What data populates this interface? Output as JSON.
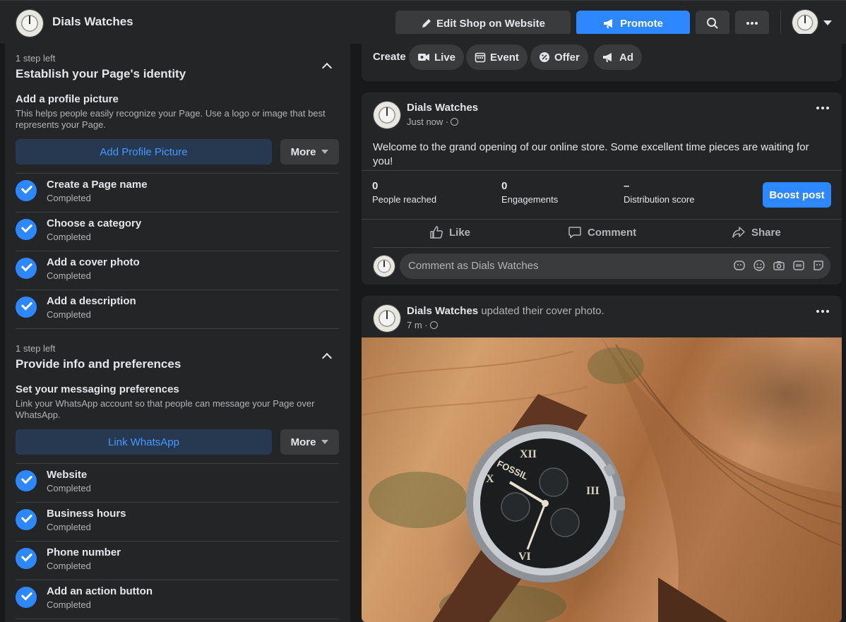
{
  "header": {
    "page_name": "Dials Watches",
    "edit_shop_label": "Edit Shop on Website",
    "promote_label": "Promote"
  },
  "setup": {
    "sections": [
      {
        "steps_left": "1 step left",
        "title": "Establish your Page's identity",
        "task_title": "Add a profile picture",
        "task_desc": "This helps people easily recognize your Page. Use a logo or image that best represents your Page.",
        "cta_label": "Add Profile Picture",
        "more_label": "More",
        "items": [
          {
            "title": "Create a Page name",
            "status": "Completed"
          },
          {
            "title": "Choose a category",
            "status": "Completed"
          },
          {
            "title": "Add a cover photo",
            "status": "Completed"
          },
          {
            "title": "Add a description",
            "status": "Completed"
          }
        ]
      },
      {
        "steps_left": "1 step left",
        "title": "Provide info and preferences",
        "task_title": "Set your messaging preferences",
        "task_desc": "Link your WhatsApp account so that people can message your Page over WhatsApp.",
        "cta_label": "Link WhatsApp",
        "more_label": "More",
        "items": [
          {
            "title": "Website",
            "status": "Completed"
          },
          {
            "title": "Business hours",
            "status": "Completed"
          },
          {
            "title": "Phone number",
            "status": "Completed"
          },
          {
            "title": "Add an action button",
            "status": "Completed"
          }
        ]
      }
    ]
  },
  "create_bar": {
    "label": "Create",
    "options": [
      "Live",
      "Event",
      "Offer",
      "Ad"
    ]
  },
  "posts": [
    {
      "author": "Dials Watches",
      "time": "Just now ·",
      "text": "Welcome to the grand opening of our online store. Some excellent time pieces are waiting for you!",
      "stats": [
        {
          "value": "0",
          "label": "People reached"
        },
        {
          "value": "0",
          "label": "Engagements"
        },
        {
          "value": "–",
          "label": "Distribution score"
        }
      ],
      "boost_label": "Boost post",
      "actions": [
        "Like",
        "Comment",
        "Share"
      ],
      "comment_placeholder": "Comment as Dials Watches"
    },
    {
      "author": "Dials Watches",
      "activity": "updated their cover photo.",
      "time": "7 m ·",
      "photo_brand_text": "FOSSIL"
    }
  ],
  "colors": {
    "accent": "#2d88ff",
    "card": "#242526",
    "background": "#18191a"
  }
}
